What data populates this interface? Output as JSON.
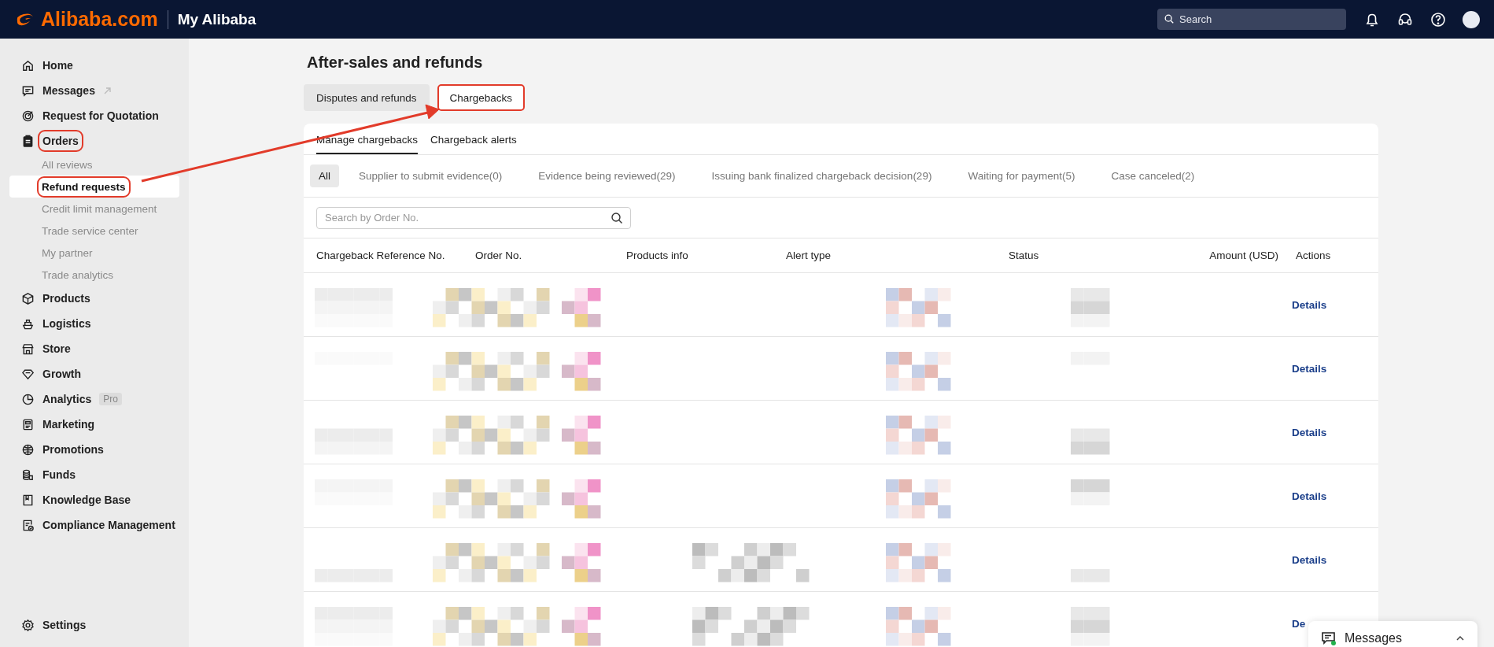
{
  "header": {
    "logo": "Alibaba.com",
    "title": "My Alibaba",
    "search": {
      "placeholder": "Search"
    }
  },
  "sidebar": {
    "items": [
      {
        "kind": "main",
        "label": "Home",
        "selected": false,
        "highlighted": false
      },
      {
        "kind": "main",
        "label": "Messages",
        "selected": false,
        "highlighted": false,
        "external": true
      },
      {
        "kind": "main",
        "label": "Request for Quotation",
        "selected": false,
        "highlighted": false
      },
      {
        "kind": "main",
        "label": "Orders",
        "selected": false,
        "highlighted": true
      },
      {
        "kind": "sub",
        "label": "All reviews",
        "selected": false,
        "highlighted": false
      },
      {
        "kind": "sub",
        "label": "Refund requests",
        "selected": true,
        "highlighted": true
      },
      {
        "kind": "sub",
        "label": "Credit limit management",
        "selected": false,
        "highlighted": false
      },
      {
        "kind": "sub",
        "label": "Trade service center",
        "selected": false,
        "highlighted": false
      },
      {
        "kind": "sub",
        "label": "My partner",
        "selected": false,
        "highlighted": false
      },
      {
        "kind": "sub",
        "label": "Trade analytics",
        "selected": false,
        "highlighted": false
      },
      {
        "kind": "main",
        "label": "Products",
        "selected": false,
        "highlighted": false
      },
      {
        "kind": "main",
        "label": "Logistics",
        "selected": false,
        "highlighted": false
      },
      {
        "kind": "main",
        "label": "Store",
        "selected": false,
        "highlighted": false
      },
      {
        "kind": "main",
        "label": "Growth",
        "selected": false,
        "highlighted": false
      },
      {
        "kind": "main",
        "label": "Analytics",
        "selected": false,
        "highlighted": false,
        "badge": "Pro"
      },
      {
        "kind": "main",
        "label": "Marketing",
        "selected": false,
        "highlighted": false
      },
      {
        "kind": "main",
        "label": "Promotions",
        "selected": false,
        "highlighted": false
      },
      {
        "kind": "main",
        "label": "Funds",
        "selected": false,
        "highlighted": false
      },
      {
        "kind": "main",
        "label": "Knowledge Base",
        "selected": false,
        "highlighted": false
      },
      {
        "kind": "main",
        "label": "Compliance Management",
        "selected": false,
        "highlighted": false
      }
    ],
    "settings": "Settings"
  },
  "page": {
    "title": "After-sales and refunds",
    "tabs": [
      {
        "label": "Disputes and refunds",
        "selected": false,
        "highlighted": false
      },
      {
        "label": "Chargebacks",
        "selected": true,
        "highlighted": true
      }
    ],
    "subtabs": [
      {
        "label": "Manage chargebacks",
        "selected": true
      },
      {
        "label": "Chargeback alerts",
        "selected": false
      }
    ],
    "filters": [
      {
        "label": "All",
        "selected": true
      },
      {
        "label": "Supplier to submit evidence(0)",
        "selected": false
      },
      {
        "label": "Evidence being reviewed(29)",
        "selected": false
      },
      {
        "label": "Issuing bank finalized chargeback decision(29)",
        "selected": false
      },
      {
        "label": "Waiting for payment(5)",
        "selected": false
      },
      {
        "label": "Case canceled(2)",
        "selected": false
      }
    ],
    "search": {
      "placeholder": "Search by Order No."
    },
    "table": {
      "columns": [
        "Chargeback Reference No.",
        "Order No.",
        "Products info",
        "Alert type",
        "Status",
        "Amount (USD)",
        "Actions"
      ],
      "rows": [
        {
          "action": "Details"
        },
        {
          "action": "Details"
        },
        {
          "action": "Details"
        },
        {
          "action": "Details"
        },
        {
          "action": "Details"
        },
        {
          "action": "De"
        }
      ]
    }
  },
  "messages_widget": {
    "label": "Messages",
    "online": true
  }
}
